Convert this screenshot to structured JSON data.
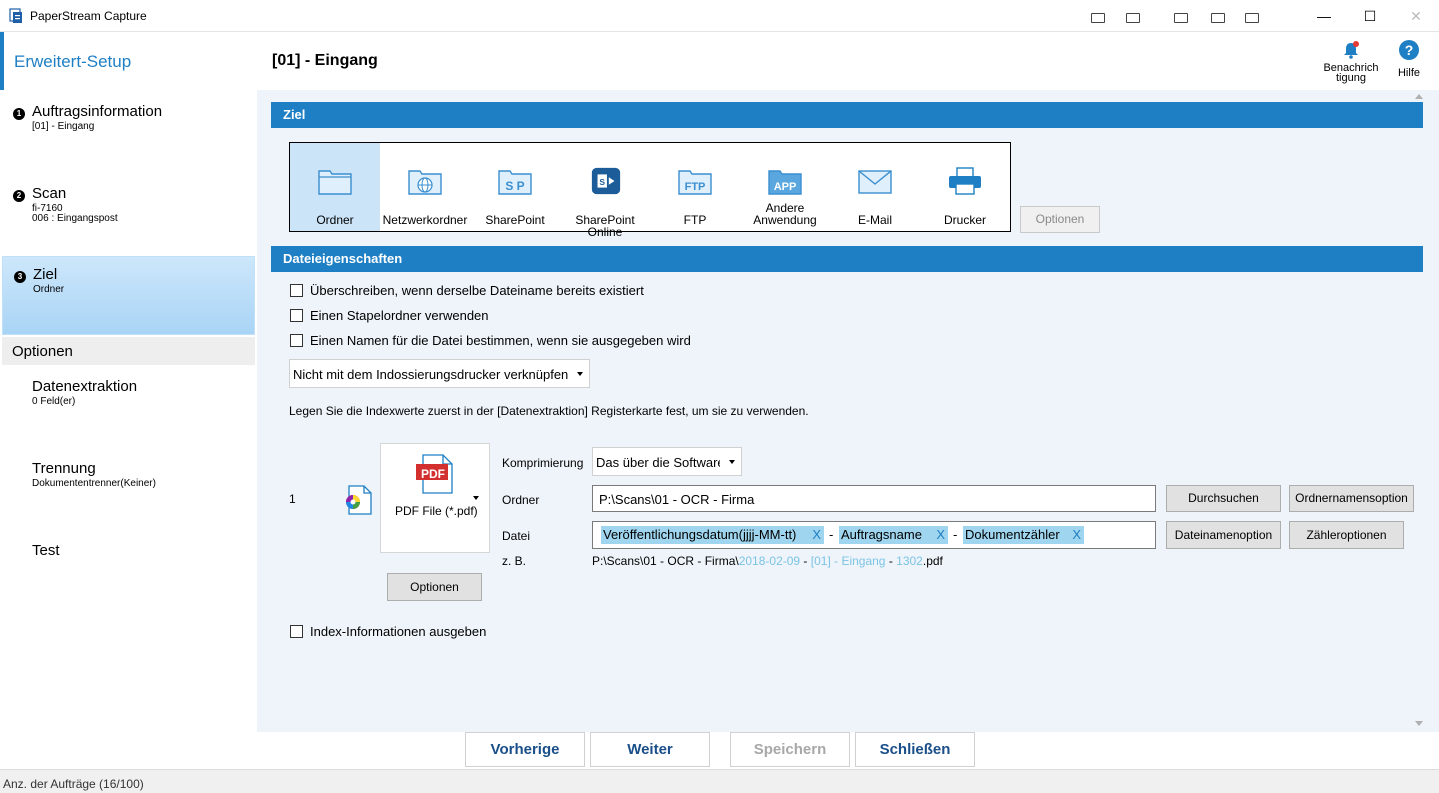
{
  "window": {
    "title": "PaperStream Capture",
    "minimize": "—",
    "maximize": "☐",
    "close": "✕"
  },
  "sidebar": {
    "title": "Erweitert-Setup",
    "steps": [
      {
        "num": "1",
        "label": "Auftragsinformation",
        "sub1": "[01] - Eingang",
        "sub2": ""
      },
      {
        "num": "2",
        "label": "Scan",
        "sub1": "fi-7160",
        "sub2": "006 : Eingangspost"
      },
      {
        "num": "3",
        "label": "Ziel",
        "sub1": "Ordner",
        "sub2": ""
      }
    ],
    "options_header": "Optionen",
    "options": [
      {
        "label": "Datenextraktion",
        "sub": "0 Feld(er)"
      },
      {
        "label": "Trennung",
        "sub": "Dokumententrenner(Keiner)"
      },
      {
        "label": "Test",
        "sub": ""
      }
    ]
  },
  "header": {
    "page_title": "[01] - Eingang",
    "notification_label_1": "Benachrich",
    "notification_label_2": "tigung",
    "help_label": "Hilfe"
  },
  "ziel": {
    "section_title": "Ziel",
    "destinations": [
      {
        "label": "Ordner",
        "label2": "",
        "icon": "folder-icon"
      },
      {
        "label": "Netzwerkordner",
        "label2": "",
        "icon": "network-folder-icon"
      },
      {
        "label": "SharePoint",
        "label2": "",
        "icon": "sharepoint-icon"
      },
      {
        "label": "SharePoint Online",
        "label2": "",
        "icon": "sharepoint-online-icon"
      },
      {
        "label": "FTP",
        "label2": "",
        "icon": "ftp-icon"
      },
      {
        "label": "Andere",
        "label2": "Anwendung",
        "icon": "app-icon"
      },
      {
        "label": "E-Mail",
        "label2": "",
        "icon": "email-icon"
      },
      {
        "label": "Drucker",
        "label2": "",
        "icon": "printer-icon"
      }
    ],
    "options_button": "Optionen"
  },
  "file_props": {
    "section_title": "Dateieigenschaften",
    "checkboxes": [
      "Überschreiben, wenn derselbe Dateiname bereits existiert",
      "Einen Stapelordner verwenden",
      "Einen Namen für die Datei bestimmen, wenn sie ausgegeben wird"
    ],
    "imprinter_select": "Nicht mit dem Indossierungsdrucker verknüpfen",
    "hint": "Legen Sie die Indexwerte zuerst in der [Datenextraktion] Registerkarte fest, um sie zu verwenden.",
    "row_number": "1",
    "format_label": "PDF File (*.pdf)",
    "format_badge": "PDF",
    "format_options_button": "Optionen",
    "compression_label": "Komprimierung",
    "compression_value": "Das über die Software",
    "folder_label": "Ordner",
    "folder_value": "P:\\Scans\\01 - OCR - Firma",
    "browse_button": "Durchsuchen",
    "folder_name_option_button": "Ordnernamensoption",
    "file_label": "Datei",
    "file_tokens": [
      "Veröffentlichungsdatum(jjjj-MM-tt)",
      "Auftragsname",
      "Dokumentzähler"
    ],
    "token_separator": "-",
    "token_remove": "X",
    "filename_option_button": "Dateinamenoption",
    "counter_options_button": "Zähleroptionen",
    "example_label": "z. B.",
    "example_prefix": "P:\\Scans\\01 - OCR - Firma\\",
    "example_date": "2018-02-09",
    "example_sep": " - ",
    "example_job": "[01] - Eingang",
    "example_counter": "1302",
    "example_ext": ".pdf",
    "index_checkbox": "Index-Informationen ausgeben"
  },
  "footer": {
    "prev": "Vorherige",
    "next": "Weiter",
    "save": "Speichern",
    "close": "Schließen"
  },
  "status": {
    "text": "Anz. der Aufträge (16/100)"
  },
  "colors": {
    "accent": "#1e7fc4",
    "token_bg": "#9fd5ee",
    "example_highlight": "#7cc4e4"
  }
}
